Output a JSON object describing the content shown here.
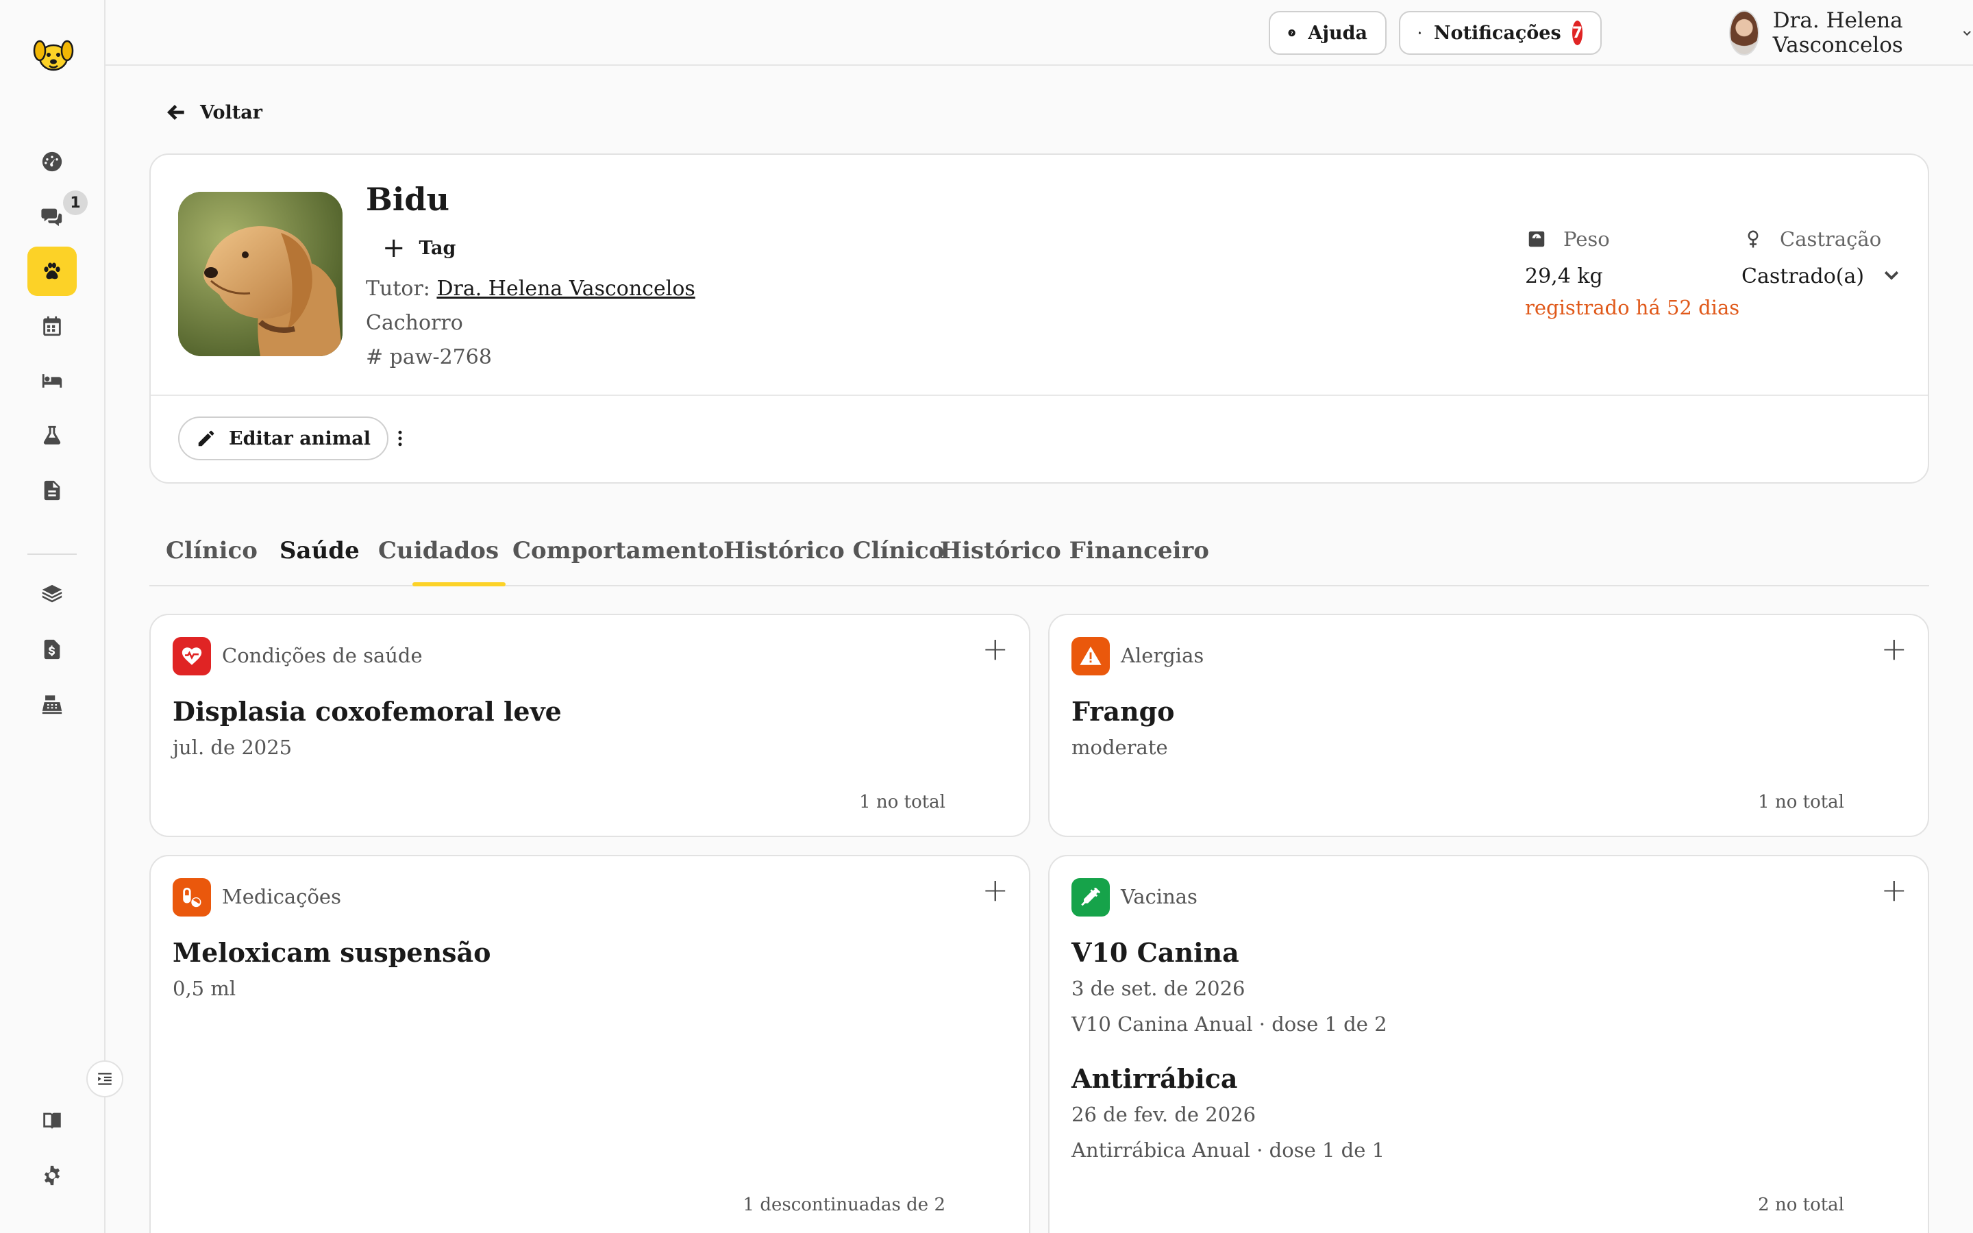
{
  "sidebar": {
    "chat_badge": "1"
  },
  "header": {
    "help_label": "Ajuda",
    "notifications_label": "Notificações",
    "notifications_count": "7",
    "user_name": "Dra. Helena Vasconcelos"
  },
  "back_label": "Voltar",
  "pet": {
    "name": "Bidu",
    "tag_label": "Tag",
    "tutor_prefix": "Tutor:",
    "tutor_name": "Dra. Helena Vasconcelos",
    "species": "Cachorro",
    "id": "# paw-2768",
    "weight_label": "Peso",
    "weight_value": "29,4 kg",
    "weight_note": "registrado há 52 dias",
    "castration_label": "Castração",
    "castration_value": "Castrado(a)",
    "edit_label": "Editar animal"
  },
  "tabs": [
    "Clínico",
    "Saúde",
    "Cuidados",
    "Comportamento",
    "Histórico Clínico",
    "Histórico Financeiro"
  ],
  "active_tab": "Saúde",
  "cards": {
    "conditions": {
      "title": "Condições de saúde",
      "item_name": "Displasia coxofemoral leve",
      "item_date": "jul. de 2025",
      "footer": "1 no total"
    },
    "allergies": {
      "title": "Alergias",
      "item_name": "Frango",
      "item_severity": "moderate",
      "footer": "1 no total"
    },
    "medications": {
      "title": "Medicações",
      "item_name": "Meloxicam suspensão",
      "item_dose": "0,5 ml",
      "footer": "1 descontinuadas de 2"
    },
    "vaccines": {
      "title": "Vacinas",
      "items": [
        {
          "name": "V10 Canina",
          "date": "3 de set. de 2026",
          "protocol": "V10 Canina Anual · dose 1 de 2"
        },
        {
          "name": "Antirrábica",
          "date": "26 de fev. de 2026",
          "protocol": "Antirrábica Anual · dose 1 de 1"
        }
      ],
      "footer": "2 no total"
    }
  },
  "colors": {
    "accent": "#fcd227",
    "conditions_icon": "#e02424",
    "allergies_icon": "#ea580c",
    "medications_icon": "#ea580c",
    "vaccines_icon": "#16a34a",
    "warning_text": "#e0591a"
  }
}
